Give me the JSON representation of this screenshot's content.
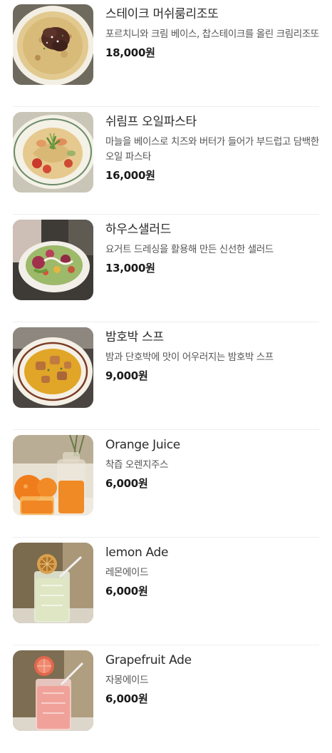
{
  "menu": {
    "items": [
      {
        "name": "스테이크 머쉬룸리조또",
        "description": "포르치니와 크림 베이스, 찹스테이크를 올린 크림리조또",
        "price": "18,000원",
        "image": "steak-mushroom-risotto-photo"
      },
      {
        "name": "쉬림프 오일파스타",
        "description": "마늘을 베이스로 치즈와 버터가 들어가 부드럽고 담백한 오일 파스타",
        "price": "16,000원",
        "image": "shrimp-oil-pasta-photo"
      },
      {
        "name": "하우스샐러드",
        "description": "요거트 드레싱을 활용해 만든 신선한 샐러드",
        "price": "13,000원",
        "image": "house-salad-photo"
      },
      {
        "name": "밤호박 스프",
        "description": "밤과 단호박에 맛이 어우러지는 밤호박 스프",
        "price": "9,000원",
        "image": "sweet-pumpkin-soup-photo"
      },
      {
        "name": "Orange Juice",
        "description": "착즙 오렌지주스",
        "price": "6,000원",
        "image": "orange-juice-photo"
      },
      {
        "name": "lemon Ade",
        "description": "레몬에이드",
        "price": "6,000원",
        "image": "lemon-ade-photo"
      },
      {
        "name": "Grapefruit Ade",
        "description": "자몽에이드",
        "price": "6,000원",
        "image": "grapefruit-ade-photo"
      }
    ]
  }
}
